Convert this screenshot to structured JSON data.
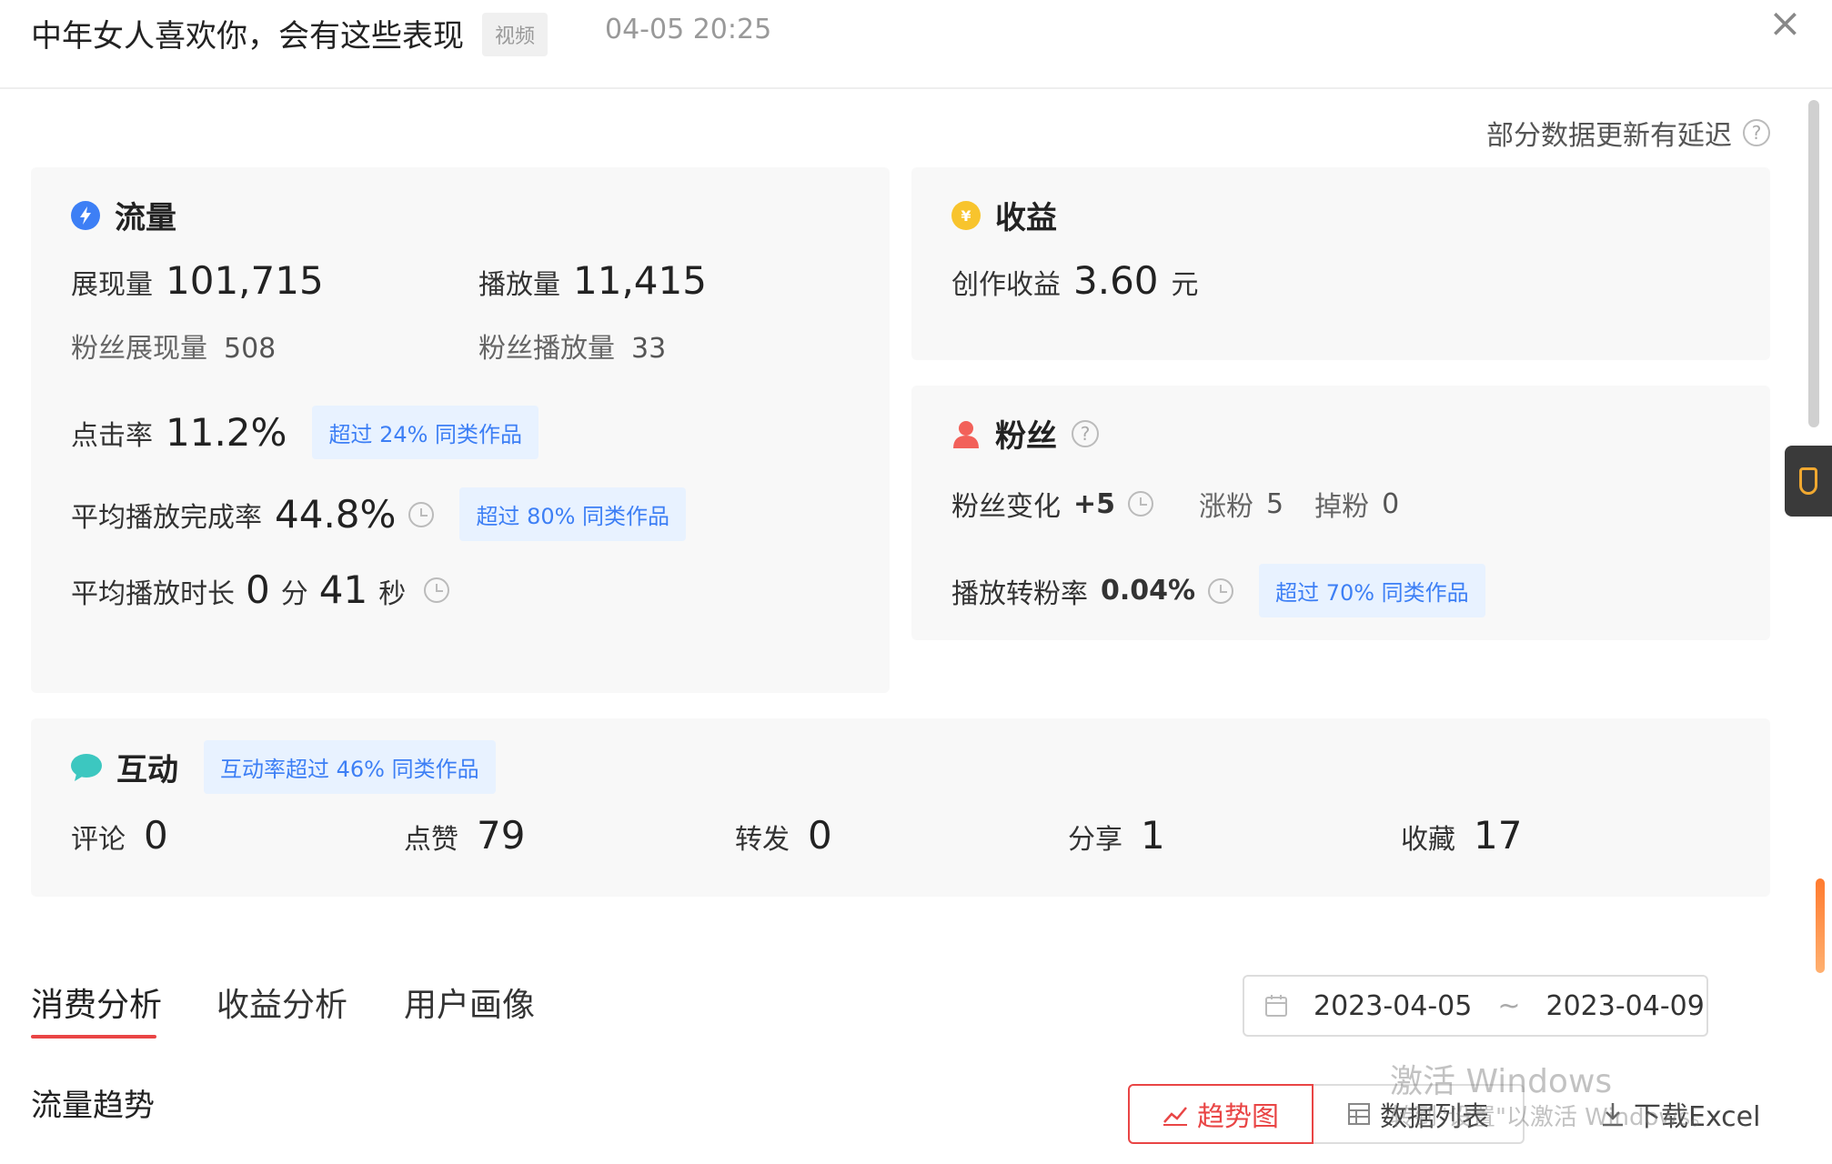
{
  "header": {
    "title": "中年女人喜欢你，会有这些表现",
    "type_tag": "视频",
    "timestamp": "04-05 20:25",
    "close_icon": "close-icon"
  },
  "notice": {
    "text": "部分数据更新有延迟",
    "icon": "question-icon"
  },
  "traffic": {
    "title": "流量",
    "icon": "lightning-icon",
    "impressions_label": "展现量",
    "impressions_value": "101,715",
    "plays_label": "播放量",
    "plays_value": "11,415",
    "fan_impressions_label": "粉丝展现量",
    "fan_impressions_value": "508",
    "fan_plays_label": "粉丝播放量",
    "fan_plays_value": "33",
    "ctr_label": "点击率",
    "ctr_value": "11.2%",
    "ctr_badge": "超过 24% 同类作品",
    "completion_label": "平均播放完成率",
    "completion_value": "44.8%",
    "completion_badge": "超过 80% 同类作品",
    "duration_label": "平均播放时长",
    "duration_min": "0",
    "duration_min_unit": "分",
    "duration_sec": "41",
    "duration_sec_unit": "秒"
  },
  "earnings": {
    "title": "收益",
    "icon": "coin-icon",
    "creation_label": "创作收益",
    "creation_value": "3.60",
    "creation_unit": "元"
  },
  "fans": {
    "title": "粉丝",
    "icon": "person-icon",
    "change_label": "粉丝变化",
    "change_value": "+5",
    "gain_label": "涨粉",
    "gain_value": "5",
    "loss_label": "掉粉",
    "loss_value": "0",
    "conversion_label": "播放转粉率",
    "conversion_value": "0.04%",
    "conversion_badge": "超过 70% 同类作品"
  },
  "interaction": {
    "title": "互动",
    "icon": "chat-bubble-icon",
    "badge": "互动率超过 46% 同类作品",
    "stats": [
      {
        "label": "评论",
        "value": "0"
      },
      {
        "label": "点赞",
        "value": "79"
      },
      {
        "label": "转发",
        "value": "0"
      },
      {
        "label": "分享",
        "value": "1"
      },
      {
        "label": "收藏",
        "value": "17"
      }
    ]
  },
  "tabs": [
    {
      "label": "消费分析",
      "active": true
    },
    {
      "label": "收益分析",
      "active": false
    },
    {
      "label": "用户画像",
      "active": false
    }
  ],
  "date_range": {
    "start": "2023-04-05",
    "separator": "~",
    "end": "2023-04-09"
  },
  "trend": {
    "title": "流量趋势",
    "chart_button": "趋势图",
    "table_button": "数据列表",
    "download_button": "下载Excel"
  },
  "watermark": {
    "line1": "激活 Windows",
    "line2": "转到\"设置\"以激活 Windows。"
  },
  "colors": {
    "accent_red": "#e94545",
    "badge_blue": "#3d7ff5",
    "traffic_blue": "#3d7ff5",
    "earnings_gold": "#f8c42d",
    "fans_red": "#f2615a",
    "interaction_teal": "#3cc7c0"
  }
}
